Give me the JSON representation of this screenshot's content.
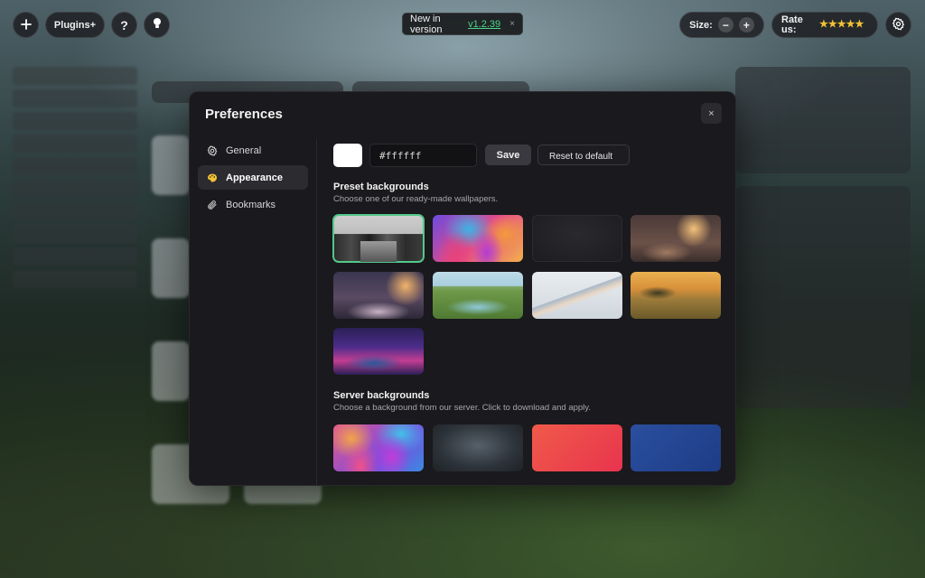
{
  "topbar": {
    "add_icon": "plus-icon",
    "plugins_label": "Plugins+",
    "help_label": "?",
    "tip_icon": "lightbulb-icon",
    "version_prefix": "New in version",
    "version_number": "v1.2.39",
    "version_close": "×",
    "size_label": "Size:",
    "size_minus": "−",
    "size_plus": "+",
    "rate_label": "Rate us:",
    "rate_stars": "★★★★★",
    "settings_icon": "gear-icon"
  },
  "modal": {
    "title": "Preferences",
    "close": "×",
    "nav": [
      {
        "label": "General",
        "icon": "gear-icon"
      },
      {
        "label": "Appearance",
        "icon": "palette-icon",
        "active": true
      },
      {
        "label": "Bookmarks",
        "icon": "paperclip-icon"
      }
    ],
    "color": {
      "value": "#ffffff",
      "swatch": "#ffffff",
      "save_label": "Save",
      "reset_label": "Reset to default"
    },
    "preset": {
      "title": "Preset backgrounds",
      "subtitle": "Choose one of our ready-made wallpapers.",
      "selected_index": 0
    },
    "server": {
      "title": "Server backgrounds",
      "subtitle": "Choose a background from our server. Click to download and apply."
    }
  },
  "colors": {
    "accent_green": "#52c88a",
    "star_yellow": "#f2c233"
  }
}
